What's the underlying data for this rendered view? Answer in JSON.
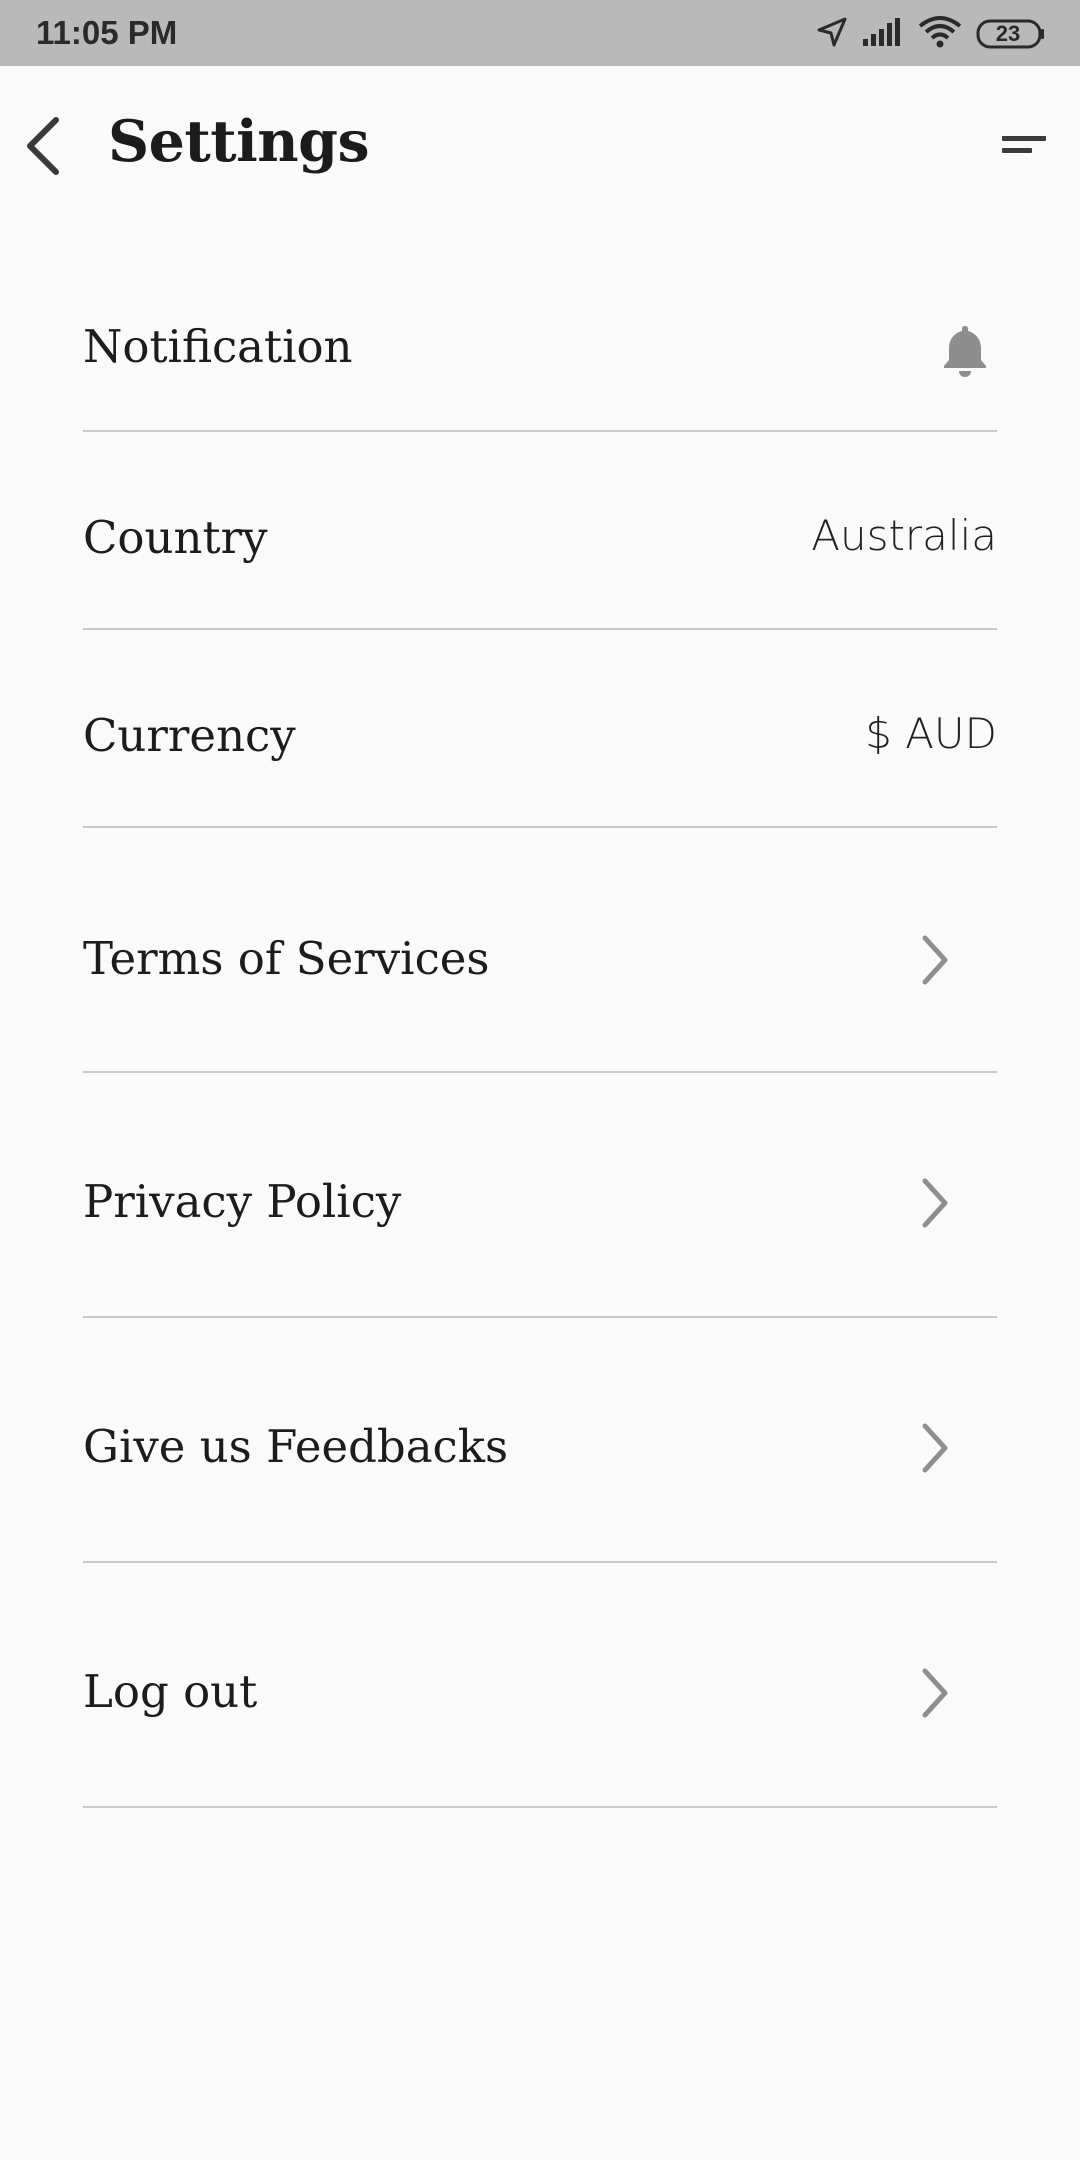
{
  "status_bar": {
    "time": "11:05 PM",
    "battery": "23",
    "icons": [
      "location-arrow-icon",
      "signal-icon",
      "wifi-icon",
      "battery-icon"
    ]
  },
  "header": {
    "title": "Settings",
    "back_icon": "back-arrow-icon",
    "menu_icon": "menu-icon"
  },
  "settings": {
    "notification": {
      "label": "Notification",
      "icon": "bell-icon"
    },
    "country": {
      "label": "Country",
      "value": "Australia"
    },
    "currency": {
      "label": "Currency",
      "value": "$ AUD"
    },
    "terms": {
      "label": "Terms of Services",
      "icon": "chevron-right-icon"
    },
    "privacy": {
      "label": "Privacy Policy",
      "icon": "chevron-right-icon"
    },
    "feedback": {
      "label": "Give us Feedbacks",
      "icon": "chevron-right-icon"
    },
    "logout": {
      "label": "Log out",
      "icon": "chevron-right-icon"
    }
  },
  "colors": {
    "status_bar": "#b9b9b9",
    "background": "#fafafa",
    "text": "#1c1c1c",
    "divider": "#c9c9c9",
    "icon_gray": "#8e8e8e"
  }
}
